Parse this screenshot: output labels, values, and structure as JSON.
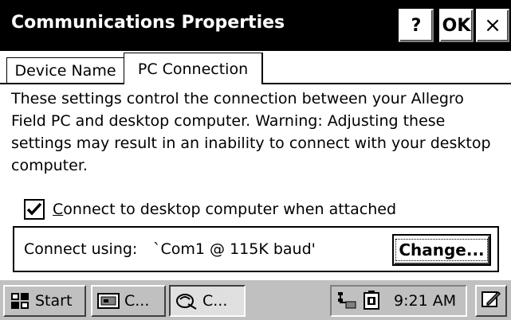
{
  "window": {
    "title": "Communications Properties",
    "help_label": "?",
    "ok_label": "OK",
    "close_label": "×"
  },
  "tabs": [
    {
      "label": "Device Name",
      "active": false
    },
    {
      "label": "PC Connection",
      "active": true
    }
  ],
  "description": "These settings control the connection between your Allegro Field PC and desktop computer.  Warning: Adjusting these settings may result in an inability to connect with your desktop computer.",
  "checkbox": {
    "checked": true,
    "label_first_letter": "C",
    "label_rest": "onnect to desktop computer when attached"
  },
  "connection": {
    "label": "Connect using:",
    "value": "`Com1 @ 115K baud'",
    "change_label": "Change..."
  },
  "taskbar": {
    "start_label": "Start",
    "task1_label": "C...",
    "task2_label": "C...",
    "time": "9:21 AM"
  },
  "icons": {
    "start": "windows-flag-icon",
    "task1": "control-panel-icon",
    "task2": "communications-icon",
    "tray_connection": "connection-icon",
    "tray_battery": "battery-icon",
    "pen": "pen-icon"
  }
}
